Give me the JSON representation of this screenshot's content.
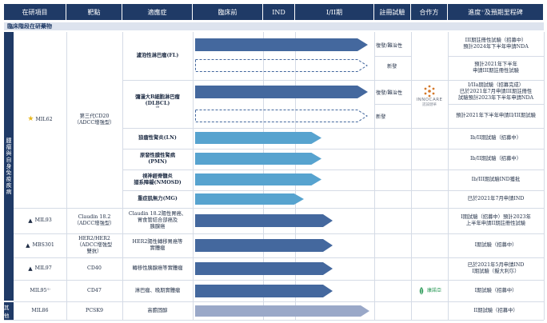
{
  "headers": [
    "在研項目",
    "靶點",
    "適應症",
    "臨床前",
    "IND",
    "I/II期",
    "註冊試驗",
    "合作方",
    "進度",
    "及預期里程碑"
  ],
  "header_note_mark": "⁽¹⁾",
  "section_title": "臨床階段在研藥物",
  "categories": {
    "main": "腫瘤與自身免疫疾病",
    "other": "其他"
  },
  "colors": {
    "header_bg": "#1f3a66",
    "bar_dark": "#44689e",
    "bar_light": "#57a3cf",
    "bar_grey": "#9aa8c8",
    "innocare": "#d4782a",
    "kangnuoya": "#2e9b5a"
  },
  "drugs": {
    "mil62": {
      "name": "MIL62",
      "target_line1": "第三代CD20",
      "target_line2": "（ADCC增強型）"
    },
    "mil93": {
      "name": "MIL93",
      "target_line1": "Claudin 18.2",
      "target_line2": "（ADCC增強型）"
    },
    "mbs301": {
      "name": "MBS301",
      "target_line1": "HER2/HER2",
      "target_line2": "（ADCC增強型",
      "target_line3": "雙抗）"
    },
    "mil97": {
      "name": "MIL97",
      "target_line1": "CD40"
    },
    "mil95": {
      "name": "MIL95",
      "sup": "⁽²⁾",
      "target_line1": "CD47"
    },
    "mil86": {
      "name": "MIL86",
      "target_line1": "PCSK9"
    }
  },
  "indications": {
    "fl": {
      "line1": "濾泡性淋巴瘤(FL)"
    },
    "dlbcl": {
      "line1": "彌漫大B細胞淋巴瘤",
      "line2": "(DLBCL)",
      "sup": "⁽³⁾"
    },
    "ln": {
      "line1": "狼瘡性腎炎(LN)"
    },
    "pmn": {
      "line1": "原發性膜性腎病",
      "line2": "(PMN)"
    },
    "nmosd": {
      "line1": "視神經脊髓炎",
      "line2": "譜系障礙(NMOSD)"
    },
    "mg": {
      "line1": "重症肌無力(MG)"
    },
    "mil93": {
      "line1": "Claudin 18.2陽性胃癌、",
      "line2": "胃食管結合部癌及",
      "line3": "胰腺癌"
    },
    "mbs301": {
      "line1": "HER2陽性轉移胃癌等",
      "line2": "實體瘤"
    },
    "mil97": {
      "line1": "轉移性胰腺癌等實體瘤"
    },
    "mil95": {
      "line1": "淋巴瘤、晚期實體瘤"
    },
    "mil86": {
      "line1": "高膽固醇"
    }
  },
  "bar_notes": {
    "fl_rr": "復發/難治性",
    "fl_new": "新發",
    "dlbcl_rr": "復發/難治性",
    "dlbcl_new": "新發"
  },
  "partners": {
    "innocare": "INNOCARE",
    "innocare_cn": "諾誠健華",
    "kangnuoya": "康諾亞"
  },
  "progress": {
    "fl_rr": {
      "line1": "III期註冊性試驗（招募中）",
      "line2": "預計2024年下半年申請NDA"
    },
    "fl_new": {
      "line1": "預計2021年下半年",
      "line2": "申請III期註冊性試驗"
    },
    "dlbcl_rr": {
      "line1": "I/IIa期試驗（招募完成）",
      "line2": "已於2021年7月申請III期註冊性",
      "line3": "試驗預計2023年下半年申請NDA"
    },
    "dlbcl_new": {
      "line1": "預計2021年下半年申請II/III期試驗"
    },
    "ln": {
      "line1": "Ib/II期試驗（招募中）"
    },
    "pmn": {
      "line1": "Ib/II期試驗（招募中）"
    },
    "nmosd": {
      "line1": "Ib/III期試驗IND獲批"
    },
    "mg": {
      "line1": "已於2021年7月申請IND"
    },
    "mil93": {
      "line1": "I期試驗（招募中）預計2023年",
      "line2": "上半年申請II期註冊性試驗"
    },
    "mbs301": {
      "line1": "I期試驗（招募中）"
    },
    "mil97": {
      "line1": "已於2021年5月申請IND",
      "line2": "I期試驗（擬大利尓）"
    },
    "mil95": {
      "line1": "I期試驗（招募中）"
    },
    "mil86": {
      "line1": "II期試驗（招募中）"
    }
  }
}
